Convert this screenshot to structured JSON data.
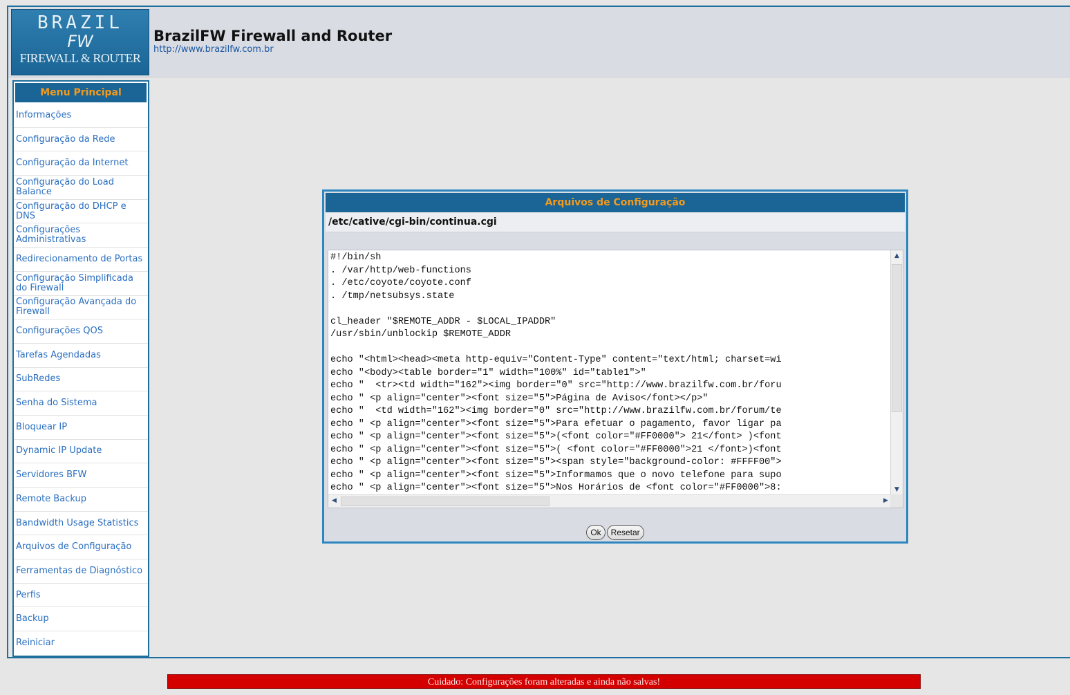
{
  "header": {
    "logo_line1": "BRAZIL",
    "logo_line2": "FW",
    "logo_line3": "FIREWALL & ROUTER",
    "title": "BrazilFW Firewall and Router",
    "url": "http://www.brazilfw.com.br"
  },
  "menu": {
    "heading": "Menu Principal",
    "items": [
      {
        "label": "Informações"
      },
      {
        "label": "Configuração da Rede"
      },
      {
        "label": "Configuração da Internet"
      },
      {
        "label": "Configuração do Load Balance"
      },
      {
        "label": "Configuração do DHCP e DNS"
      },
      {
        "label": "Configurações Administrativas"
      },
      {
        "label": "Redirecionamento de Portas"
      },
      {
        "label": "Configuração Simplificada do Firewall"
      },
      {
        "label": "Configuração Avançada do Firewall"
      },
      {
        "label": "Configurações QOS"
      },
      {
        "label": "Tarefas Agendadas"
      },
      {
        "label": "SubRedes"
      },
      {
        "label": "Senha do Sistema"
      },
      {
        "label": "Bloquear IP"
      },
      {
        "label": "Dynamic IP Update"
      },
      {
        "label": "Servidores BFW"
      },
      {
        "label": "Remote Backup"
      },
      {
        "label": "Bandwidth Usage Statistics"
      },
      {
        "label": "Arquivos de Configuração"
      },
      {
        "label": "Ferramentas de Diagnóstico"
      },
      {
        "label": "Perfis"
      },
      {
        "label": "Backup"
      },
      {
        "label": "Reiniciar"
      }
    ]
  },
  "dialog": {
    "title": "Arquivos de Configuração",
    "file_path": "/etc/cative/cgi-bin/continua.cgi",
    "file_content": "#!/bin/sh\n. /var/http/web-functions\n. /etc/coyote/coyote.conf\n. /tmp/netsubsys.state\n\ncl_header \"$REMOTE_ADDR - $LOCAL_IPADDR\"\n/usr/sbin/unblockip $REMOTE_ADDR\n\necho \"<html><head><meta http-equiv=\"Content-Type\" content=\"text/html; charset=wi\necho \"<body><table border=\"1\" width=\"100%\" id=\"table1\">\"\necho \"  <tr><td width=\"162\"><img border=\"0\" src=\"http://www.brazilfw.com.br/foru\necho \" <p align=\"center\"><font size=\"5\">Página de Aviso</font></p>\"\necho \"  <td width=\"162\"><img border=\"0\" src=\"http://www.brazilfw.com.br/forum/te\necho \" <p align=\"center\"><font size=\"5\">Para efetuar o pagamento, favor ligar pa\necho \" <p align=\"center\"><font size=\"5\">(<font color=\"#FF0000\"> 21</font> )<font\necho \" <p align=\"center\"><font size=\"5\">( <font color=\"#FF0000\">21 </font>)<font\necho \" <p align=\"center\"><font size=\"5\"><span style=\"background-color: #FFFF00\">\necho \" <p align=\"center\"><font size=\"5\">Informamos que o novo telefone para supo\necho \" <p align=\"center\"><font size=\"5\">Nos Horários de <font color=\"#FF0000\">8:",
    "ok_label": "Ok",
    "reset_label": "Resetar"
  },
  "warning": "Cuidado: Configurações foram alteradas e ainda não salvas!",
  "colors": {
    "accent_blue": "#1a6596",
    "heading_orange": "#f39a1d",
    "link_blue": "#2a6fc0",
    "warning_red": "#d40000"
  }
}
